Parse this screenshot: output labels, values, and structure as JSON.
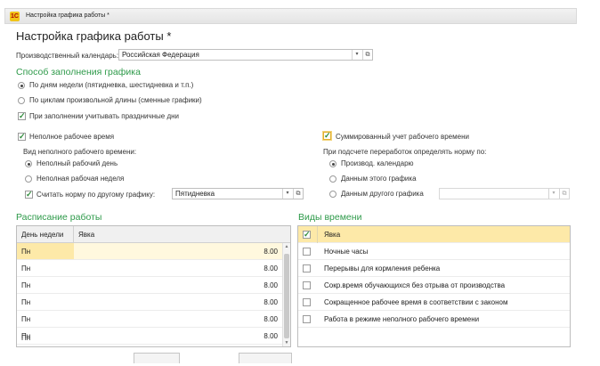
{
  "window": {
    "title": "Настройка графика работы *"
  },
  "page_title": "Настройка графика работы *",
  "calendar": {
    "label": "Производственный календарь:",
    "value": "Российская Федерация"
  },
  "fill_method": {
    "title": "Способ заполнения графика",
    "options": [
      {
        "label": "По дням недели (пятидневка, шестидневка и т.п.)",
        "selected": true
      },
      {
        "label": "По циклам произвольной длины (сменные графики)",
        "selected": false
      }
    ],
    "holidays_check": {
      "label": "При заполнении учитывать праздничные дни",
      "checked": true
    }
  },
  "part_time": {
    "check_label": "Неполное рабочее время",
    "kind_label": "Вид неполного рабочего времени:",
    "options": [
      {
        "label": "Неполный рабочий день",
        "selected": true
      },
      {
        "label": "Неполная рабочая неделя",
        "selected": false
      }
    ],
    "norm_check_label": "Считать норму по другому графику:",
    "norm_schedule": "Пятидневка"
  },
  "summarized": {
    "check_label": "Суммированный учет рабочего времени",
    "norm_label": "При подсчете переработок определять норму по:",
    "options": [
      {
        "label": "Производ. календарю",
        "selected": true
      },
      {
        "label": "Данным этого графика",
        "selected": false
      },
      {
        "label": "Данным другого графика",
        "selected": false
      }
    ],
    "other_schedule": ""
  },
  "schedule": {
    "title": "Расписание работы",
    "columns": [
      "День недели",
      "Явка"
    ],
    "rows": [
      {
        "day": "Пн",
        "value": "8.00"
      },
      {
        "day": "Пн",
        "value": "8.00"
      },
      {
        "day": "Пн",
        "value": "8.00"
      },
      {
        "day": "Пн",
        "value": "8.00"
      },
      {
        "day": "Пн",
        "value": "8.00"
      },
      {
        "day": "Пн",
        "value": "8.00"
      },
      {
        "day": "Пн",
        "value": ""
      }
    ]
  },
  "time_types": {
    "title": "Виды времени",
    "items": [
      {
        "label": "Явка",
        "checked": true
      },
      {
        "label": "Ночные часы",
        "checked": false
      },
      {
        "label": "Перерывы для кормления ребенка",
        "checked": false
      },
      {
        "label": "Сокр.время обучающихся без отрыва от производства",
        "checked": false
      },
      {
        "label": "Сокращенное рабочее время в соответствии с законом",
        "checked": false
      },
      {
        "label": "Работа в режиме неполного рабочего времени",
        "checked": false
      }
    ]
  },
  "icons": {
    "app": "app-logo-icon",
    "dropdown": "chevron-down-icon",
    "open": "open-form-icon",
    "check": "checkmark-icon",
    "scroll_up": "scroll-up-icon",
    "scroll_down": "scroll-down-icon"
  },
  "colors": {
    "section_title": "#2e9a4a",
    "selected_row": "#fde9a8",
    "check": "#2e8b3a"
  }
}
